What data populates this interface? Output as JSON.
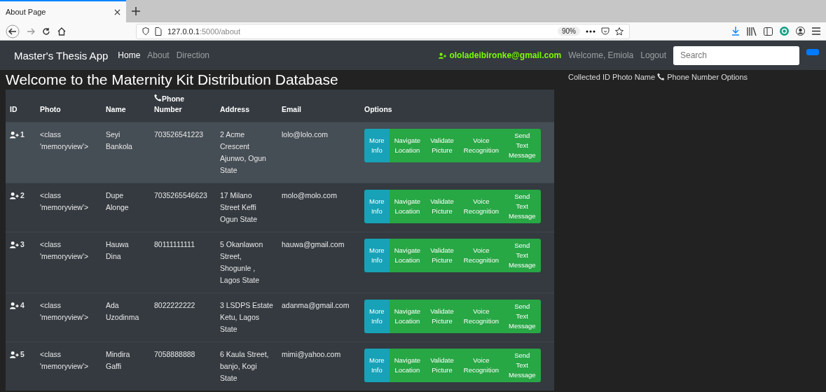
{
  "browser": {
    "tab_title": "About Page",
    "url_host": "127.0.0.1",
    "url_path": ":5000/about",
    "zoom": "90%"
  },
  "navbar": {
    "brand": "Master's Thesis App",
    "links": [
      {
        "label": "Home",
        "selected": true
      },
      {
        "label": "About",
        "selected": false
      },
      {
        "label": "Direction",
        "selected": false
      }
    ],
    "user_email": "ololadeibironke@gmail.com",
    "welcome": "Welcome, Emiola",
    "logout": "Logout",
    "search": {
      "placeholder": "Search"
    }
  },
  "heading": "Welcome to the Maternity Kit Distribution Database",
  "table": {
    "columns": [
      {
        "label": "ID",
        "phone_icon": false
      },
      {
        "label": "Photo",
        "phone_icon": false
      },
      {
        "label": "Name",
        "phone_icon": false
      },
      {
        "label": "Phone Number",
        "phone_icon": true
      },
      {
        "label": "Address",
        "phone_icon": false
      },
      {
        "label": "Email",
        "phone_icon": false
      },
      {
        "label": "Options",
        "phone_icon": false
      }
    ],
    "rows": [
      {
        "highlighted": true,
        "id": "1",
        "photo": "<class 'memoryview'>",
        "name": "Seyi Bankola",
        "phone": "703526541223",
        "address": "2 Acme Crescent Ajunwo, Ogun State",
        "email": "lolo@lolo.com",
        "options": [
          {
            "label": "More Info",
            "kind": "info"
          },
          {
            "label": "Navigate Location",
            "kind": "success"
          },
          {
            "label": "Validate Picture",
            "kind": "success"
          },
          {
            "label": "Voice Recognition",
            "kind": "success"
          },
          {
            "label": "Send Text Message",
            "kind": "success"
          }
        ]
      },
      {
        "highlighted": false,
        "id": "2",
        "photo": "<class 'memoryview'>",
        "name": "Dupe Alonge",
        "phone": "7035265546623",
        "address": "17 Milano Street Keffi Ogun State",
        "email": "molo@molo.com",
        "options": [
          {
            "label": "More Info",
            "kind": "info"
          },
          {
            "label": "Navigate Location",
            "kind": "success"
          },
          {
            "label": "Validate Picture",
            "kind": "success"
          },
          {
            "label": "Voice Recognition",
            "kind": "success"
          },
          {
            "label": "Send Text Message",
            "kind": "success"
          }
        ]
      },
      {
        "highlighted": false,
        "id": "3",
        "photo": "<class 'memoryview'>",
        "name": "Hauwa Dina",
        "phone": "80111111111",
        "address": "5 Okanlawon Street, Shogunle , Lagos State",
        "email": "hauwa@gmail.com",
        "options": [
          {
            "label": "More Info",
            "kind": "info"
          },
          {
            "label": "Navigate Location",
            "kind": "success"
          },
          {
            "label": "Validate Picture",
            "kind": "success"
          },
          {
            "label": "Voice Recognition",
            "kind": "success"
          },
          {
            "label": "Send Text Message",
            "kind": "success"
          }
        ]
      },
      {
        "highlighted": false,
        "id": "4",
        "photo": "<class 'memoryview'>",
        "name": "Ada Uzodinma",
        "phone": "8022222222",
        "address": "3 LSDPS Estate Ketu, Lagos State",
        "email": "adanma@gmail.com",
        "options": [
          {
            "label": "More Info",
            "kind": "info"
          },
          {
            "label": "Navigate Location",
            "kind": "success"
          },
          {
            "label": "Validate Picture",
            "kind": "success"
          },
          {
            "label": "Voice Recognition",
            "kind": "success"
          },
          {
            "label": "Send Text Message",
            "kind": "success"
          }
        ]
      },
      {
        "highlighted": false,
        "id": "5",
        "photo": "<class 'memoryview'>",
        "name": "Mindira Gaffi",
        "phone": "7058888888",
        "address": "6 Kaula Street, banjo, Kogi State",
        "email": "mimi@yahoo.com",
        "options": [
          {
            "label": "More Info",
            "kind": "info"
          },
          {
            "label": "Navigate Location",
            "kind": "success"
          },
          {
            "label": "Validate Picture",
            "kind": "success"
          },
          {
            "label": "Voice Recognition",
            "kind": "success"
          },
          {
            "label": "Send Text Message",
            "kind": "success"
          }
        ]
      }
    ]
  },
  "side_panel": {
    "text_before_icon": "Collected ID Photo Name",
    "text_after_icon": "Phone Number Options"
  }
}
